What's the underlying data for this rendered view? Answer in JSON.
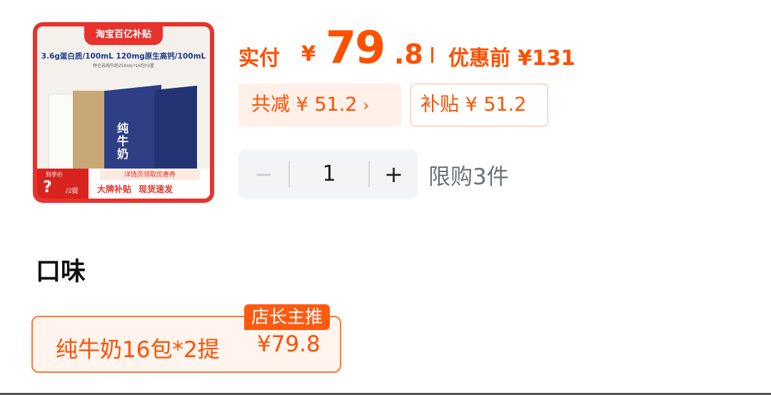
{
  "product_image": {
    "badge": "淘宝百亿补贴",
    "spec_line": "3.6g蛋白质/100mL  120mg原生高钙/100mL",
    "spec_sub": "特仑苏纯牛奶250mL*16包*2提",
    "box_label": "纯牛奶",
    "hand_price_label": "到手价",
    "hand_price_value": "?",
    "hand_price_unit": "/2提",
    "coupon_text": "详情页领取优惠券",
    "tags": "大牌补贴 现货速发"
  },
  "price": {
    "paid_label": "实付",
    "currency": "¥",
    "paid_int": "79",
    "paid_dec": ".8",
    "original_label": "优惠前 ¥131"
  },
  "discounts": {
    "total_reduce": "共减 ¥ 51.2",
    "total_reduce_chevron": "›",
    "subsidy": "补贴 ¥ 51.2"
  },
  "quantity": {
    "minus": "−",
    "value": "1",
    "plus": "+",
    "limit_text": "限购3件"
  },
  "flavor": {
    "title": "口味",
    "options": [
      {
        "label": "纯牛奶16包*2提",
        "price": "¥79.8",
        "badge": "店长主推",
        "selected": true
      }
    ]
  },
  "colors": {
    "accent": "#ff5000",
    "accent_light": "#fff0e8",
    "muted_text": "#6b7079",
    "stepper_bg": "#f3f4f6"
  }
}
